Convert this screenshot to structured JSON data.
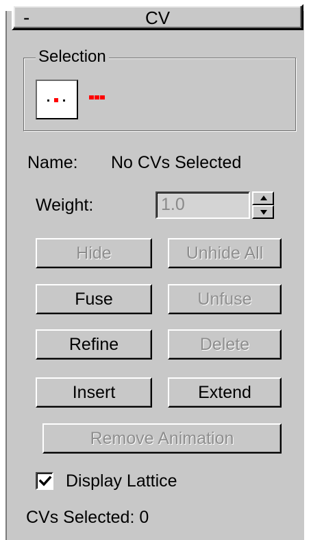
{
  "rollout": {
    "collapse_glyph": "-",
    "title": "CV"
  },
  "selection": {
    "group_label": "Selection",
    "cv_level_icon": "cv-dot-icon",
    "cv_level_selected": true
  },
  "name_row": {
    "label": "Name:",
    "value": "No CVs Selected"
  },
  "weight_row": {
    "label": "Weight:",
    "value": "1.0",
    "enabled": false
  },
  "buttons": {
    "hide": {
      "label": "Hide",
      "enabled": false
    },
    "unhide_all": {
      "label": "Unhide All",
      "enabled": false
    },
    "fuse": {
      "label": "Fuse",
      "enabled": true
    },
    "unfuse": {
      "label": "Unfuse",
      "enabled": false
    },
    "refine": {
      "label": "Refine",
      "enabled": true
    },
    "delete": {
      "label": "Delete",
      "enabled": false
    },
    "insert": {
      "label": "Insert",
      "enabled": true
    },
    "extend": {
      "label": "Extend",
      "enabled": true
    },
    "remove_animation": {
      "label": "Remove Animation",
      "enabled": false
    }
  },
  "display_lattice": {
    "label": "Display Lattice",
    "checked": true
  },
  "status": {
    "text": "CVs Selected: 0"
  },
  "colors": {
    "panel_bg": "#c8c8c8",
    "disabled_text": "#8e8e8e",
    "cv_red": "#ff0000"
  }
}
